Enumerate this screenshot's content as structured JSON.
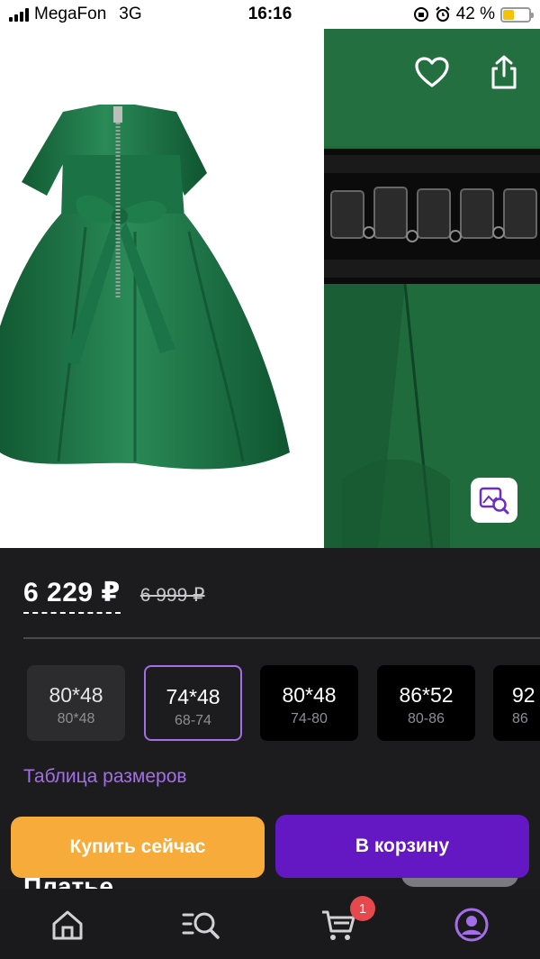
{
  "status_bar": {
    "carrier": "MegaFon",
    "network": "3G",
    "time": "16:16",
    "battery": "42 %",
    "battery_level": 0.42,
    "icons": [
      "signal-icon",
      "screen-rotation-lock-icon",
      "alarm-icon",
      "battery-icon"
    ]
  },
  "gallery": {
    "images": [
      "green-dress-back-photo",
      "dress-waistband-detail-photo"
    ],
    "icons": [
      "back-arrow-icon",
      "heart-icon",
      "share-icon",
      "image-search-icon"
    ]
  },
  "price": {
    "current": "6 229 ₽",
    "old": "6 999 ₽"
  },
  "sizes": [
    {
      "main": "80*48",
      "sub": "80*48",
      "state": "unavailable"
    },
    {
      "main": "74*48",
      "sub": "68-74",
      "state": "selected"
    },
    {
      "main": "80*48",
      "sub": "74-80",
      "state": "available"
    },
    {
      "main": "86*52",
      "sub": "80-86",
      "state": "available"
    },
    {
      "main": "92",
      "sub": "86",
      "state": "available"
    }
  ],
  "size_table_link": "Таблица размеров",
  "product_title_partial": "Платье",
  "actions": {
    "buy_now": "Купить сейчас",
    "add_to_cart": "В корзину"
  },
  "bottom_nav": {
    "items": [
      "home-icon",
      "catalog-search-icon",
      "cart-icon",
      "profile-icon"
    ],
    "cart_badge": "1"
  },
  "colors": {
    "accent": "#a46ee8",
    "buy_button": "#f6ab3b",
    "cart_button": "#6418c3",
    "background": "#1c1c1e",
    "badge": "#e5484d"
  }
}
